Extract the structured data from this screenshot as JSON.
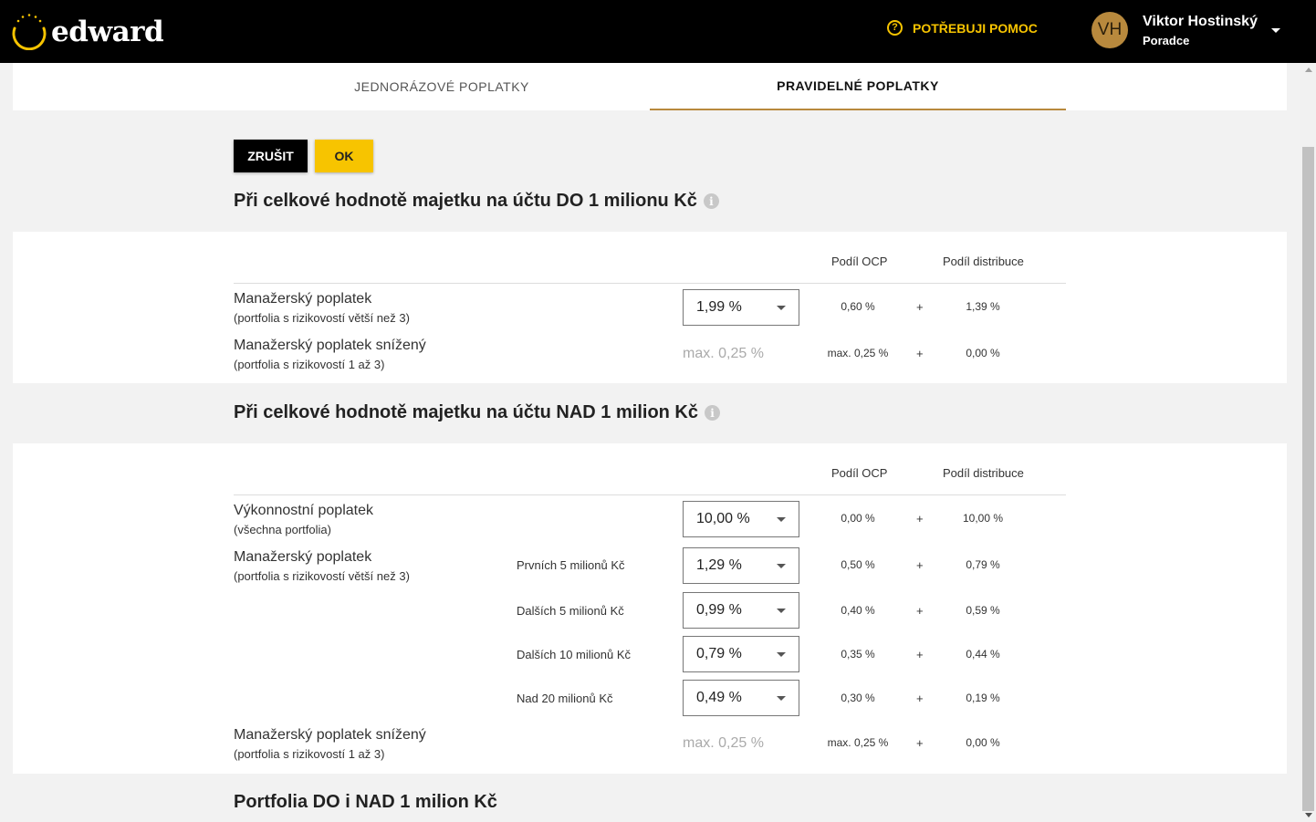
{
  "header": {
    "logo_text": "edward",
    "help_label": "POTŘEBUJI POMOC",
    "user": {
      "initials": "VH",
      "name": "Viktor Hostinský",
      "role": "Poradce"
    }
  },
  "tabs": [
    {
      "label": "JEDNORÁZOVÉ POPLATKY",
      "active": false
    },
    {
      "label": "PRAVIDELNÉ POPLATKY",
      "active": true
    }
  ],
  "actions": {
    "cancel_label": "ZRUŠIT",
    "ok_label": "OK"
  },
  "section1": {
    "title": "Při celkové hodnotě majetku na účtu DO 1 milionu Kč",
    "col_ocp": "Podíl OCP",
    "col_dist": "Podíl distribuce",
    "rows": [
      {
        "label": "Manažerský poplatek",
        "sub": "(portfolia s rizikovostí větší než 3)",
        "select": "1,99 %",
        "ocp": "0,60 %",
        "plus": "+",
        "dist": "1,39 %"
      },
      {
        "label": "Manažerský poplatek snížený",
        "sub": "(portfolia s rizikovostí 1 až 3)",
        "max": "max. 0,25 %",
        "ocp": "max. 0,25 %",
        "plus": "+",
        "dist": "0,00 %"
      }
    ]
  },
  "section2": {
    "title": "Při celkové hodnotě majetku na účtu NAD 1 milion Kč",
    "col_ocp": "Podíl OCP",
    "col_dist": "Podíl distribuce",
    "performance": {
      "label": "Výkonnostní poplatek",
      "sub": "(všechna portfolia)",
      "select": "10,00 %",
      "ocp": "0,00 %",
      "plus": "+",
      "dist": "10,00 %"
    },
    "management": {
      "label": "Manažerský poplatek",
      "sub": "(portfolia s rizikovostí větší než 3)",
      "tiers": [
        {
          "tier": "Prvních 5 milionů Kč",
          "select": "1,29 %",
          "ocp": "0,50 %",
          "plus": "+",
          "dist": "0,79 %"
        },
        {
          "tier": "Dalších 5 milionů Kč",
          "select": "0,99 %",
          "ocp": "0,40 %",
          "plus": "+",
          "dist": "0,59 %"
        },
        {
          "tier": "Dalších 10 milionů Kč",
          "select": "0,79 %",
          "ocp": "0,35 %",
          "plus": "+",
          "dist": "0,44 %"
        },
        {
          "tier": "Nad 20 milionů Kč",
          "select": "0,49 %",
          "ocp": "0,30 %",
          "plus": "+",
          "dist": "0,19 %"
        }
      ]
    },
    "reduced": {
      "label": "Manažerský poplatek snížený",
      "sub": "(portfolia s rizikovostí 1 až 3)",
      "max": "max. 0,25 %",
      "ocp": "max. 0,25 %",
      "plus": "+",
      "dist": "0,00 %"
    }
  },
  "section3": {
    "title": "Portfolia DO i NAD 1 milion Kč"
  },
  "colors": {
    "accent_gold": "#b8893d",
    "yellow": "#f7c400",
    "header_bg": "#000000"
  }
}
